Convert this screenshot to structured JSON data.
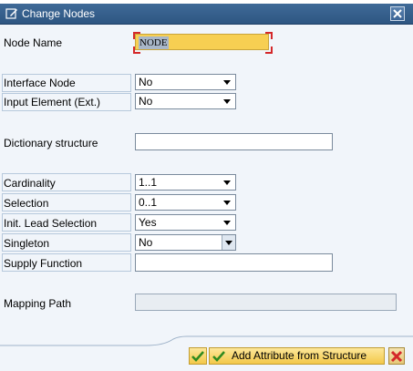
{
  "window": {
    "title": "Change Nodes"
  },
  "form": {
    "node_name": {
      "label": "Node Name",
      "value": "NODE"
    },
    "interface_node": {
      "label": "Interface Node",
      "value": "No"
    },
    "input_element": {
      "label": "Input Element (Ext.)",
      "value": "No"
    },
    "dictionary_structure": {
      "label": "Dictionary structure",
      "value": ""
    },
    "cardinality": {
      "label": "Cardinality",
      "value": "1..1"
    },
    "selection": {
      "label": "Selection",
      "value": "0..1"
    },
    "init_lead_selection": {
      "label": "Init. Lead Selection",
      "value": "Yes"
    },
    "singleton": {
      "label": "Singleton",
      "value": "No"
    },
    "supply_function": {
      "label": "Supply Function",
      "value": ""
    },
    "mapping_path": {
      "label": "Mapping Path",
      "value": ""
    }
  },
  "footer": {
    "confirm_icon": "check-icon",
    "add_attribute_label": "Add Attribute from Structure",
    "cancel_icon": "close-icon"
  },
  "colors": {
    "titlebar": "#3a6393",
    "background": "#f1f5fa",
    "focused_field": "#f7cf52",
    "button": "#f3c84a",
    "cancel_red": "#d4282a"
  }
}
